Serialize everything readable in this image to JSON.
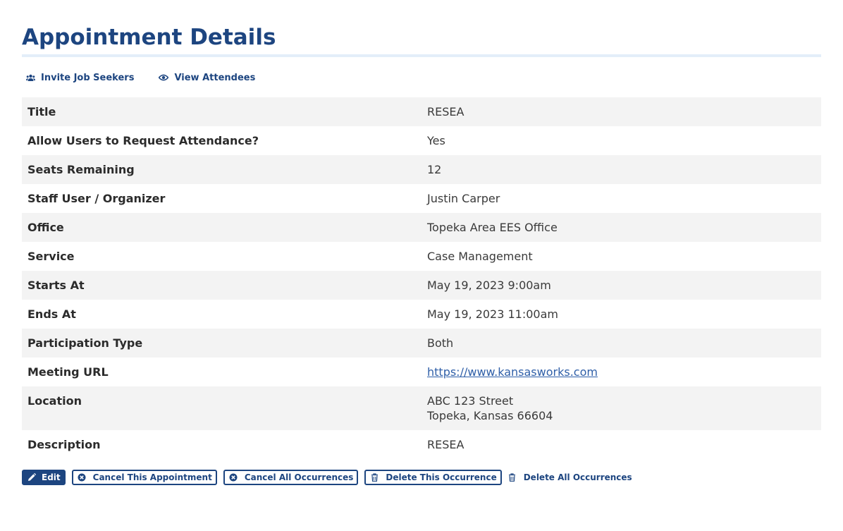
{
  "page": {
    "title": "Appointment Details"
  },
  "actions": {
    "invite_label": "Invite Job Seekers",
    "invite_icon": "users-icon",
    "view_label": "View Attendees",
    "view_icon": "eye-icon"
  },
  "details": [
    {
      "label": "Title",
      "value": "RESEA"
    },
    {
      "label": "Allow Users to Request Attendance?",
      "value": "Yes"
    },
    {
      "label": "Seats Remaining",
      "value": "12"
    },
    {
      "label": "Staff User / Organizer",
      "value": "Justin Carper"
    },
    {
      "label": "Office",
      "value": "Topeka Area EES Office"
    },
    {
      "label": "Service",
      "value": "Case Management"
    },
    {
      "label": "Starts At",
      "value": "May 19, 2023 9:00am"
    },
    {
      "label": "Ends At",
      "value": "May 19, 2023 11:00am"
    },
    {
      "label": "Participation Type",
      "value": "Both"
    },
    {
      "label": "Meeting URL",
      "value": "https://www.kansasworks.com"
    },
    {
      "label": "Location",
      "lines": [
        "ABC 123 Street",
        "Topeka, Kansas 66604"
      ]
    },
    {
      "label": "Description",
      "value": "RESEA"
    }
  ],
  "buttons": {
    "edit": {
      "label": "Edit",
      "icon": "pencil-icon"
    },
    "cancel_this": {
      "label": "Cancel This Appointment",
      "icon": "times-circle-icon"
    },
    "cancel_all": {
      "label": "Cancel All Occurrences",
      "icon": "times-circle-icon"
    },
    "delete_this": {
      "label": "Delete This Occurrence",
      "icon": "trash-icon"
    },
    "delete_all": {
      "label": "Delete All Occurrences",
      "icon": "trash-icon"
    }
  },
  "colors": {
    "brand": "#1d4580",
    "link": "#2f5fa8",
    "row_stripe": "#f3f3f3",
    "title_rule": "#e3eef9"
  }
}
